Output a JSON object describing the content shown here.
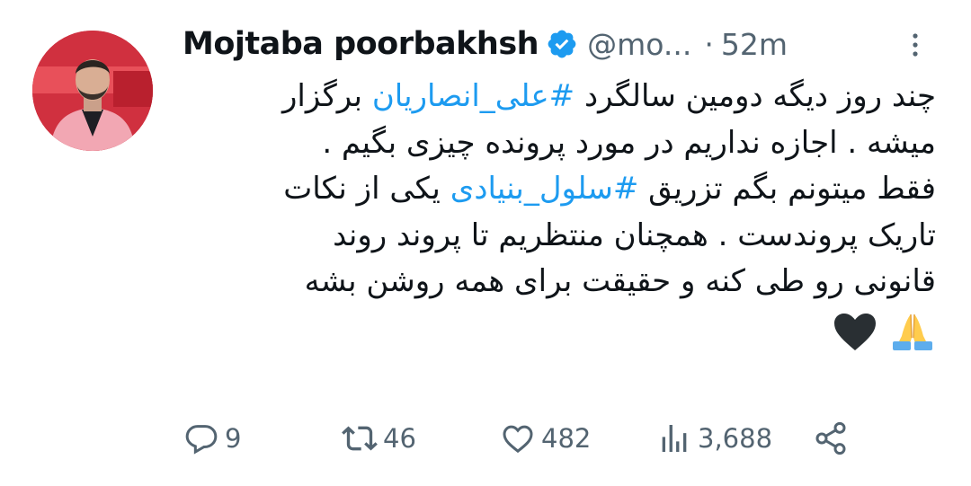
{
  "tweet": {
    "author_name": "Mojtaba poorbakhsh",
    "handle": "@mo...",
    "separator": "·",
    "time": "52m",
    "text_lines": [
      {
        "pre": "چند روز دیگه دومین سالگرد ",
        "tag": "#علی_انصاریان",
        "post": " برگزار"
      },
      {
        "pre": "میشه . اجازه نداریم در مورد پرونده چیزی بگیم .",
        "tag": "",
        "post": ""
      },
      {
        "pre": "فقط میتونم بگم تزریق ",
        "tag": "#سلول_بنیادی",
        "post": " یکی از نکات"
      },
      {
        "pre": "تاریک پروندست  . همچنان منتظریم تا پروند روند",
        "tag": "",
        "post": ""
      },
      {
        "pre": "قانونی رو طی کنه و حقیقت برای همه روشن بشه",
        "tag": "",
        "post": ""
      }
    ],
    "emojis": [
      "black-heart",
      "folded-hands"
    ]
  },
  "actions": {
    "replies": "9",
    "retweets": "46",
    "likes": "482",
    "views": "3,688"
  },
  "colors": {
    "accent": "#1d9bf0",
    "muted": "#536471",
    "text": "#0f1419"
  }
}
